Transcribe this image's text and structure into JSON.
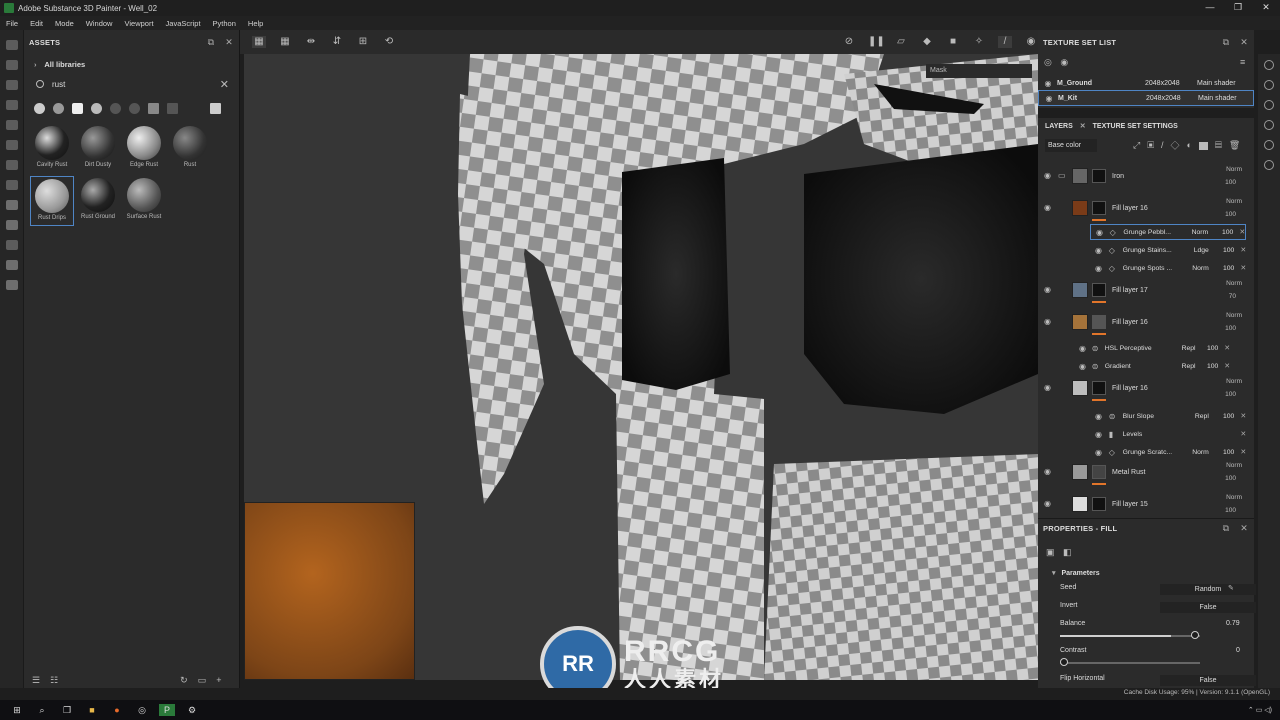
{
  "window": {
    "title": "Adobe Substance 3D Painter - Well_02",
    "controls": [
      "—",
      "❐",
      "✕"
    ]
  },
  "menu": [
    "File",
    "Edit",
    "Mode",
    "Window",
    "Viewport",
    "JavaScript",
    "Python",
    "Help"
  ],
  "assets": {
    "title": "ASSETS",
    "library": "All libraries",
    "search_value": "rust",
    "items": [
      {
        "label": "Cavity Rust",
        "color": "#4a4a4a"
      },
      {
        "label": "Dirt Dusty",
        "color": "#555555"
      },
      {
        "label": "Edge Rust",
        "color": "#8a8a8a"
      },
      {
        "label": "Rust",
        "color": "#5c5c5c"
      },
      {
        "label": "Rust Drips",
        "color": "#9b9b9b"
      },
      {
        "label": "Rust Ground",
        "color": "#3a3a3a"
      },
      {
        "label": "Surface Rust",
        "color": "#6a6a6a"
      }
    ]
  },
  "viewport": {
    "mask_field": "Mask"
  },
  "texture_set_list": {
    "title": "TEXTURE SET LIST",
    "rows": [
      {
        "name": "M_Ground",
        "size": "2048x2048",
        "shader": "Main shader"
      },
      {
        "name": "M_Kit",
        "size": "2048x2048",
        "shader": "Main shader"
      }
    ]
  },
  "layers": {
    "tab_layers": "LAYERS",
    "tab_settings": "TEXTURE SET SETTINGS",
    "channel": "Base color",
    "rows": [
      {
        "name": "Iron",
        "blend": "Norm",
        "opacity": "100"
      },
      {
        "name": "Fill layer 16",
        "blend": "Norm",
        "opacity": "100"
      },
      {
        "name": "Fill layer 17",
        "blend": "Norm",
        "opacity": "70"
      },
      {
        "name": "Fill layer 16",
        "blend": "Norm",
        "opacity": "100"
      },
      {
        "name": "Fill layer 16",
        "blend": "Norm",
        "opacity": "100"
      },
      {
        "name": "Metal Rust",
        "blend": "Norm",
        "opacity": "100"
      },
      {
        "name": "Fill layer 15",
        "blend": "Norm",
        "opacity": "100"
      }
    ],
    "effects": [
      {
        "name": "Grunge Pebbl...",
        "blend": "Norm",
        "opacity": "100"
      },
      {
        "name": "Grunge Stains...",
        "blend": "Ldge",
        "opacity": "100"
      },
      {
        "name": "Grunge Spots ...",
        "blend": "Norm",
        "opacity": "100"
      },
      {
        "name": "HSL Perceptive",
        "blend": "Repl",
        "opacity": "100"
      },
      {
        "name": "Gradient",
        "blend": "Repl",
        "opacity": "100"
      },
      {
        "name": "Blur Slope",
        "blend": "Repl",
        "opacity": "100"
      },
      {
        "name": "Levels",
        "blend": "",
        "opacity": ""
      },
      {
        "name": "Grunge Scratc...",
        "blend": "Norm",
        "opacity": "100"
      }
    ]
  },
  "properties": {
    "title": "PROPERTIES - FILL",
    "section": "Parameters",
    "seed_label": "Seed",
    "seed_value": "Random",
    "invert_label": "Invert",
    "invert_value": "False",
    "balance_label": "Balance",
    "balance_value": "0.79",
    "contrast_label": "Contrast",
    "contrast_value": "0",
    "flip_label": "Flip Horizontal",
    "flip_value": "False"
  },
  "status": {
    "text": "Cache Disk Usage:   95% | Version: 9.1.1 (OpenGL)"
  },
  "watermark": {
    "line1": "RRCG",
    "line2": "人人素材",
    "logo_text": "RR"
  },
  "colors": {
    "accent": "#4f85c5",
    "orange": "#e2752a",
    "panel": "#2b2b2b",
    "viewport": "#363636"
  }
}
